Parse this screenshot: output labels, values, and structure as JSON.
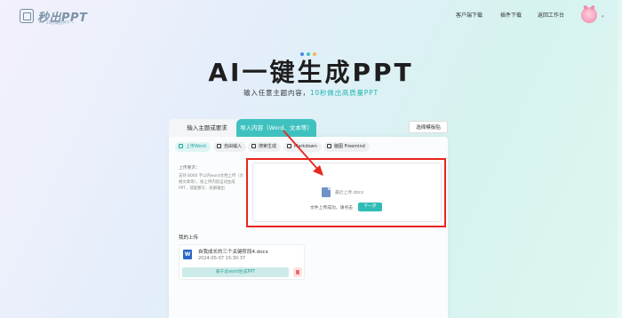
{
  "header": {
    "logo_text": "秒出PPT",
    "logo_sub": "— 10秒做出PPT —",
    "nav": [
      {
        "label": "客户端下载"
      },
      {
        "label": "插件下载"
      },
      {
        "label": "返回工作台"
      }
    ]
  },
  "hero": {
    "title": "AI一键生成PPT",
    "subtitle_prefix": "输入任意主题内容，",
    "subtitle_highlight": "10秒做出高质量PPT",
    "dot_colors": [
      "#4b86e8",
      "#3cc7bf",
      "#f2b94a"
    ]
  },
  "tabs": [
    {
      "label": "输入主题或要求"
    },
    {
      "label": "导入内容（Word、文本等）"
    }
  ],
  "template_button": "选择模板贴",
  "import_modes": [
    {
      "label": "上传Word"
    },
    {
      "label": "自由输入"
    },
    {
      "label": "搜索生成"
    },
    {
      "label": "Markdown"
    },
    {
      "label": "脑图 Freemind"
    }
  ],
  "upload": {
    "req_title": "上传要求：",
    "req_text": "支持 8000 字以内word文档上传（大纲文章等），按上传内容自动生成PPT，或能整写、拆解输出",
    "file_name": "最近上传.docx",
    "status_text": "文件上传成功，请点击",
    "next_label": "下一步"
  },
  "my_uploads": {
    "title": "我的上传",
    "items": [
      {
        "name": "自我成长的三个关键阶段4.docx",
        "time": "2024-05-07 15:30:37",
        "action": "基于此word生成PPT"
      }
    ]
  },
  "colors": {
    "accent": "#3fc2bf",
    "highlight_box": "#e8261f",
    "word_blue": "#2b67c4"
  }
}
